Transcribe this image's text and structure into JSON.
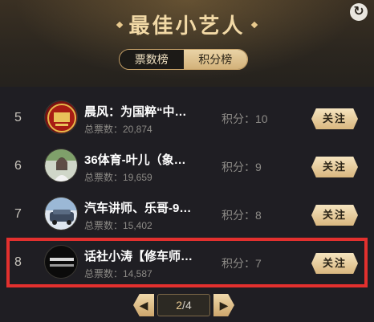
{
  "header": {
    "title": "最佳小艺人",
    "refresh_icon": "refresh-icon"
  },
  "tabs": [
    {
      "label": "票数榜",
      "active": true
    },
    {
      "label": "积分榜",
      "active": false
    }
  ],
  "list": [
    {
      "rank": "5",
      "name": "晨风：为国粹“中…",
      "total": "总票数：20,874",
      "score": "积分：10",
      "follow": "关注"
    },
    {
      "rank": "6",
      "name": "36体育-叶儿（象…",
      "total": "总票数：19,659",
      "score": "积分：9",
      "follow": "关注"
    },
    {
      "rank": "7",
      "name": "汽车讲师、乐哥-9…",
      "total": "总票数：15,402",
      "score": "积分：8",
      "follow": "关注"
    },
    {
      "rank": "8",
      "name": "话社小涛【修车师…",
      "total": "总票数：14,587",
      "score": "积分：7",
      "follow": "关注"
    }
  ],
  "pager": {
    "current": "2",
    "separator": "/",
    "total": "4"
  },
  "colors": {
    "accent_gold": "#d9b77f",
    "highlight_red": "#e3302e",
    "background": "#1f1e23"
  }
}
